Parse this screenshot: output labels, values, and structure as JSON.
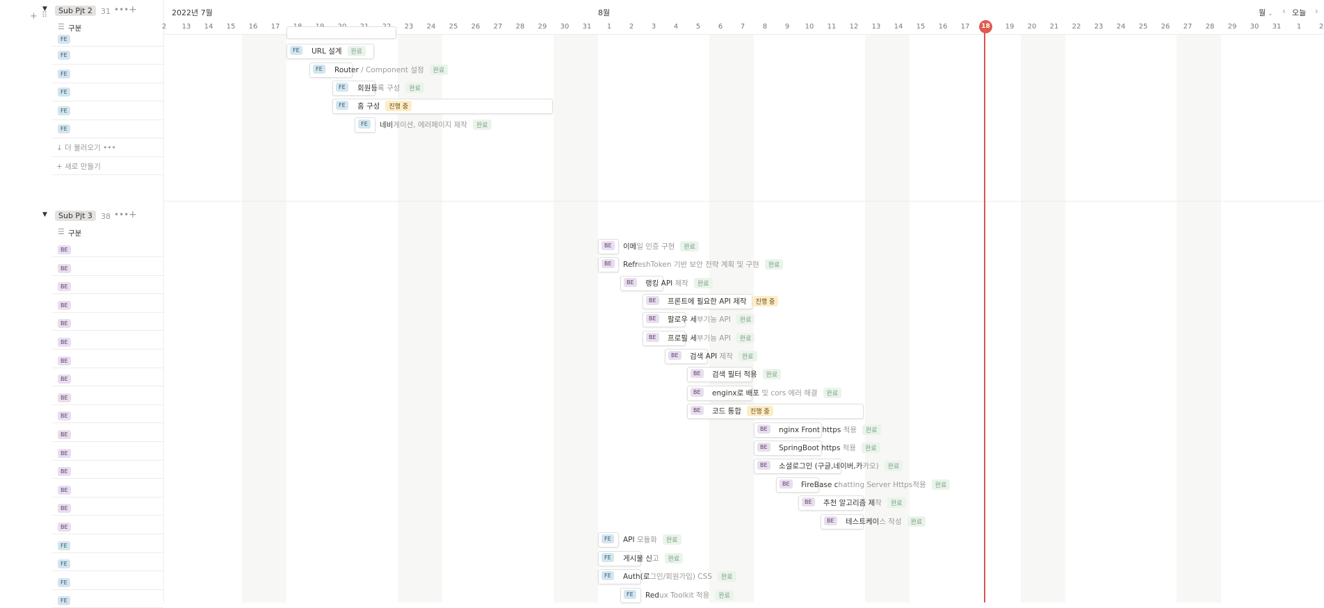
{
  "timeline": {
    "month_left": "2022년 7월",
    "month_right": "8월",
    "view_label": "월",
    "today_button": "오늘",
    "today_day": "18",
    "days": [
      "2",
      "13",
      "14",
      "15",
      "16",
      "17",
      "18",
      "19",
      "20",
      "21",
      "22",
      "23",
      "24",
      "25",
      "26",
      "27",
      "28",
      "29",
      "30",
      "31",
      "1",
      "2",
      "3",
      "4",
      "5",
      "6",
      "7",
      "8",
      "9",
      "10",
      "11",
      "12",
      "13",
      "14",
      "15",
      "16",
      "17",
      "18",
      "19",
      "20",
      "21",
      "22",
      "23",
      "24",
      "25",
      "26",
      "27",
      "28",
      "29",
      "30",
      "31",
      "1",
      "2"
    ]
  },
  "groups": [
    {
      "title": "Sub Pjt 2",
      "count": "31",
      "column_label": "구분",
      "row_tags": [
        "FE",
        "FE",
        "FE",
        "FE",
        "FE",
        "FE"
      ],
      "load_more": "더 불러오기",
      "new_item": "새로 만들기"
    },
    {
      "title": "Sub Pjt 3",
      "count": "38",
      "column_label": "구분",
      "row_tags": [
        "BE",
        "BE",
        "BE",
        "BE",
        "BE",
        "BE",
        "BE",
        "BE",
        "BE",
        "BE",
        "BE",
        "BE",
        "BE",
        "BE",
        "BE",
        "BE",
        "FE",
        "FE",
        "FE",
        "FE"
      ]
    }
  ],
  "tasks": [
    {
      "tag": "FE",
      "title": "URL 설계",
      "status": "완료"
    },
    {
      "tag": "FE",
      "title": "Router / Component 설정",
      "status": "완료"
    },
    {
      "tag": "FE",
      "title": "회원등록 구성",
      "status": "완료"
    },
    {
      "tag": "FE",
      "title": "홈 구성",
      "status": "진행 중"
    },
    {
      "tag": "FE",
      "title": "네비게이션, 에러페이지 제작",
      "status": "완료"
    },
    {
      "tag": "BE",
      "title": "이메일 인증 구현",
      "status": "완료"
    },
    {
      "tag": "BE",
      "title": "RefreshToken 기반 보안 전략 계획 및 구현",
      "status": "완료"
    },
    {
      "tag": "BE",
      "title": "랭킹 API 제작",
      "status": "완료"
    },
    {
      "tag": "BE",
      "title": "프론트에 필요한 API 제작",
      "status": "진행 중"
    },
    {
      "tag": "BE",
      "title": "팔로우 세부기능 API",
      "status": "완료"
    },
    {
      "tag": "BE",
      "title": "프로필 세부기능 API",
      "status": "완료"
    },
    {
      "tag": "BE",
      "title": "검색 API 제작",
      "status": "완료"
    },
    {
      "tag": "BE",
      "title": "검색 필터 적용",
      "status": "완료"
    },
    {
      "tag": "BE",
      "title": "enginx로 배포 및 cors 에러 해결",
      "status": "완료"
    },
    {
      "tag": "BE",
      "title": "코드 통합",
      "status": "진행 중"
    },
    {
      "tag": "BE",
      "title": "nginx Front https 적용",
      "status": "완료"
    },
    {
      "tag": "BE",
      "title": "SpringBoot https 적용",
      "status": "완료"
    },
    {
      "tag": "BE",
      "title": "소셜로그인 (구글,네이버,카카오)",
      "status": "완료"
    },
    {
      "tag": "BE",
      "title": "FireBase chatting Server Https적용",
      "status": "완료"
    },
    {
      "tag": "BE",
      "title": "추천 알고리즘 제작",
      "status": "완료"
    },
    {
      "tag": "BE",
      "title": "테스트케이스 작성",
      "status": "완료"
    },
    {
      "tag": "FE",
      "title": "API 모듈화",
      "status": "완료"
    },
    {
      "tag": "FE",
      "title": "게시물 신고",
      "status": "완료"
    },
    {
      "tag": "FE",
      "title": "Auth(로그인/회원가입) CSS",
      "status": "완료"
    },
    {
      "tag": "FE",
      "title": "Redux Toolkit 적용",
      "status": "완료"
    }
  ]
}
